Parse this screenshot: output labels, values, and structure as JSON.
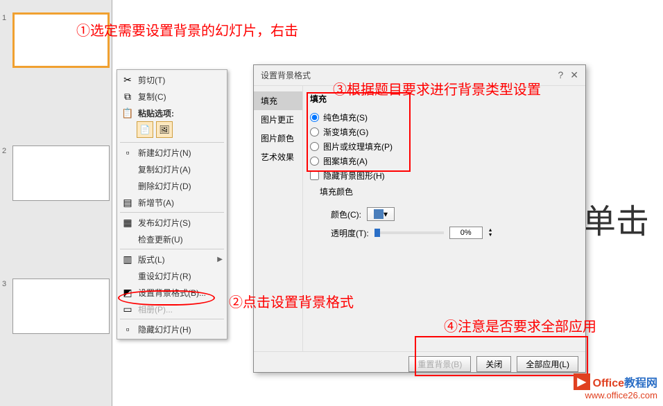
{
  "annotations": {
    "a1": "①选定需要设置背景的幻灯片，右击",
    "a2": "②点击设置背景格式",
    "a3": "③根据题目要求进行背景类型设置",
    "a4": "④注意是否要求全部应用"
  },
  "slide_canvas": {
    "title_placeholder": "单击"
  },
  "context_menu": {
    "cut": "剪切(T)",
    "copy": "复制(C)",
    "paste_options": "粘贴选项:",
    "new_slide": "新建幻灯片(N)",
    "duplicate_slide": "复制幻灯片(A)",
    "delete_slide": "删除幻灯片(D)",
    "new_section": "新增节(A)",
    "publish_slide": "发布幻灯片(S)",
    "check_update": "检查更新(U)",
    "layout": "版式(L)",
    "reset_slide": "重设幻灯片(R)",
    "format_background": "设置背景格式(B)...",
    "album": "相册(P)...",
    "hide_slide": "隐藏幻灯片(H)"
  },
  "dialog": {
    "title": "设置背景格式",
    "tabs": {
      "fill": "填充",
      "pic_correct": "图片更正",
      "pic_color": "图片颜色",
      "art_effect": "艺术效果"
    },
    "fill": {
      "legend": "填充",
      "solid": "纯色填充(S)",
      "gradient": "渐变填充(G)",
      "picture": "图片或纹理填充(P)",
      "pattern": "图案填充(A)",
      "hide_bg": "隐藏背景图形(H)",
      "fill_color_label": "填充颜色",
      "color_label": "颜色(C):",
      "transparency_label": "透明度(T):",
      "transparency_value": "0%"
    },
    "footer": {
      "reset": "重置背景(B)",
      "close": "关闭",
      "apply_all": "全部应用(L)"
    }
  },
  "watermark": {
    "brand1": "Office",
    "brand2": "教程网",
    "url": "www.office26.com"
  }
}
